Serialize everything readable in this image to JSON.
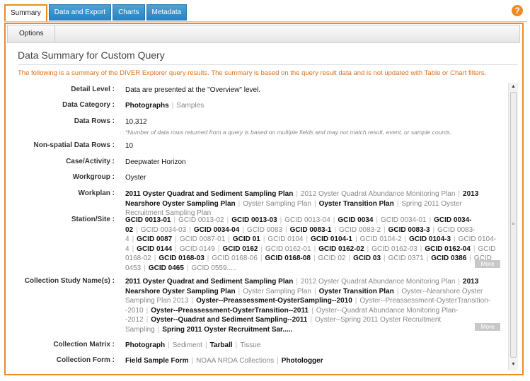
{
  "tabs": [
    "Summary",
    "Data and Export",
    "Charts",
    "Metadata"
  ],
  "help_label": "?",
  "toolbar": {
    "options_label": "Options"
  },
  "page_title": "Data Summary for Custom Query",
  "notice": "The following is a summary of the DIVER Explorer query results. The summary is based on the query result data and is not updated with Table or Chart filters.",
  "labels": {
    "detail_level": "Detail Level :",
    "data_category": "Data Category :",
    "data_rows": "Data Rows :",
    "non_spatial": "Non-spatial Data Rows :",
    "case_activity": "Case/Activity :",
    "workgroup": "Workgroup :",
    "workplan": "Workplan :",
    "station": "Station/Site :",
    "study": "Collection Study Name(s) :",
    "matrix": "Collection Matrix :",
    "form": "Collection Form :"
  },
  "values": {
    "detail_level": "Data are presented at the \"Overview\" level.",
    "data_category": [
      {
        "t": "Photographs",
        "b": true
      },
      {
        "t": "Samples",
        "b": false
      }
    ],
    "data_rows": "10,312",
    "data_rows_note": "*Number of data rows returned from a query is based on multiple fields and may not match result, event, or sample counts.",
    "non_spatial": "10",
    "case_activity": "Deepwater Horizon",
    "workgroup": "Oyster",
    "workplan": [
      {
        "t": "2011 Oyster Quadrat and Sediment Sampling Plan",
        "b": true
      },
      {
        "t": "2012 Oyster Quadrat Abundance Monitoring Plan",
        "b": false
      },
      {
        "t": "2013 Nearshore Oyster Sampling Plan",
        "b": true
      },
      {
        "t": "Oyster Sampling Plan",
        "b": false
      },
      {
        "t": "Oyster Transition Plan",
        "b": true
      },
      {
        "t": "Spring 2011 Oyster Recruitment Sampling Plan",
        "b": false
      }
    ],
    "station": [
      {
        "t": "GCID 0013-01",
        "b": true
      },
      {
        "t": "GCID 0013-02",
        "b": false
      },
      {
        "t": "GCID 0013-03",
        "b": true
      },
      {
        "t": "GCID 0013-04",
        "b": false
      },
      {
        "t": "GCID 0034",
        "b": true
      },
      {
        "t": "GCID 0034-01",
        "b": false
      },
      {
        "t": "GCID 0034-02",
        "b": true
      },
      {
        "t": "GCID 0034-03",
        "b": false
      },
      {
        "t": "GCID 0034-04",
        "b": true
      },
      {
        "t": "GCID 0083",
        "b": false
      },
      {
        "t": "GCID 0083-1",
        "b": true
      },
      {
        "t": "GCID 0083-2",
        "b": false
      },
      {
        "t": "GCID 0083-3",
        "b": true
      },
      {
        "t": "GCID 0083-4",
        "b": false
      },
      {
        "t": "GCID 0087",
        "b": true
      },
      {
        "t": "GCID 0087-01",
        "b": false
      },
      {
        "t": "GCID 01",
        "b": true
      },
      {
        "t": "GCID 0104",
        "b": false
      },
      {
        "t": "GCID 0104-1",
        "b": true
      },
      {
        "t": "GCID 0104-2",
        "b": false
      },
      {
        "t": "GCID 0104-3",
        "b": true
      },
      {
        "t": "GCID 0104-4",
        "b": false
      },
      {
        "t": "GCID 0144",
        "b": true
      },
      {
        "t": "GCID 0149",
        "b": false
      },
      {
        "t": "GCID 0162",
        "b": true
      },
      {
        "t": "GCID 0162-01",
        "b": false
      },
      {
        "t": "GCID 0162-02",
        "b": true
      },
      {
        "t": "GCID 0162-03",
        "b": false
      },
      {
        "t": "GCID 0162-04",
        "b": true
      },
      {
        "t": "GCID 0168-02",
        "b": false
      },
      {
        "t": "GCID 0168-03",
        "b": true
      },
      {
        "t": "GCID 0168-06",
        "b": false
      },
      {
        "t": "GCID 0168-08",
        "b": true
      },
      {
        "t": "GCID 02",
        "b": false
      },
      {
        "t": "GCID 03",
        "b": true
      },
      {
        "t": "GCID 0371",
        "b": false
      },
      {
        "t": "GCID 0386",
        "b": true
      },
      {
        "t": "GCID 0453",
        "b": false
      },
      {
        "t": "GCID 0465",
        "b": true
      },
      {
        "t": "GCID 0559.....",
        "b": false
      }
    ],
    "study": [
      {
        "t": "2011 Oyster Quadrat and Sediment Sampling Plan",
        "b": true
      },
      {
        "t": "2012 Oyster Quadrat Abundance Monitoring Plan",
        "b": false
      },
      {
        "t": "2013 Nearshore Oyster Sampling Plan",
        "b": true
      },
      {
        "t": "Oyster Sampling Plan",
        "b": false
      },
      {
        "t": "Oyster Transition Plan",
        "b": true
      },
      {
        "t": "Oyster--Nearshore Oyster Sampling Plan 2013",
        "b": false
      },
      {
        "t": "Oyster--Preassessment-OysterSampling--2010",
        "b": true
      },
      {
        "t": "Oyster--Preassessment-OysterTransition--2010",
        "b": false
      },
      {
        "t": "Oyster--Preassessment-OysterTransition--2011",
        "b": true
      },
      {
        "t": "Oyster--Quadrat Abundance Monitoring Plan--2012",
        "b": false
      },
      {
        "t": "Oyster--Quadrat and Sediment Sampling--2011",
        "b": true
      },
      {
        "t": "Oyster--Spring 2011 Oyster Recruitment Sampling",
        "b": false
      },
      {
        "t": "Spring 2011 Oyster Recruitment Sar.....",
        "b": true
      }
    ],
    "matrix": [
      {
        "t": "Photograph",
        "b": true
      },
      {
        "t": "Sediment",
        "b": false
      },
      {
        "t": "Tarball",
        "b": true
      },
      {
        "t": "Tissue",
        "b": false
      }
    ],
    "form": [
      {
        "t": "Field Sample Form",
        "b": true
      },
      {
        "t": "NOAA NRDA Collections",
        "b": false
      },
      {
        "t": "Photologger",
        "b": true
      }
    ]
  },
  "more_label": "More",
  "scroll": {
    "up": "▲",
    "down": "▼",
    "grip": "≡"
  },
  "colors": {
    "accent": "#f08a24",
    "tab_blue": "#2a80bd",
    "notice": "#e0701a"
  }
}
